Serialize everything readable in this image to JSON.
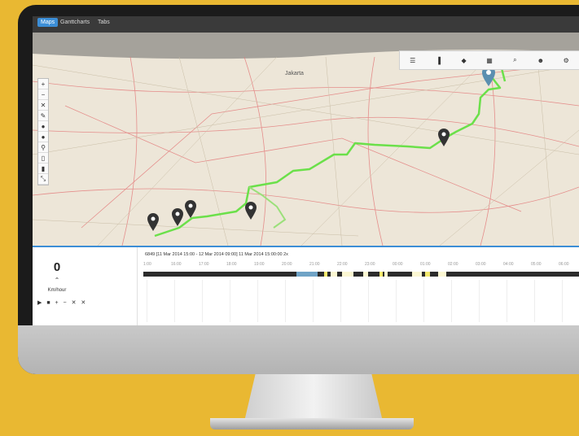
{
  "tabs": [
    {
      "label": "Maps",
      "active": true
    },
    {
      "label": "Ganttcharts",
      "active": false
    },
    {
      "label": "Tabs",
      "active": false
    }
  ],
  "map": {
    "city_label": "Jakarta",
    "markers": 7
  },
  "toolbar_icons": [
    "list-icon",
    "bookmark-icon",
    "layers-icon",
    "grid-icon",
    "search-icon",
    "user-icon",
    "settings-icon"
  ],
  "left_tools": [
    "zoom-in-icon",
    "zoom-out-icon",
    "close-icon",
    "pencil-icon",
    "point-icon",
    "point-icon",
    "marker-icon",
    "document-icon",
    "trash-icon",
    "resize-icon"
  ],
  "speed": {
    "value": "0",
    "unit": "Km/hour"
  },
  "controls_label": "▶ ■ + − ✕ ✕",
  "timeline": {
    "title": "6849 [11 Mar 2014 15:00 - 12 Mar 2014 09:00] 11 Mar 2014 15:00:00 2x",
    "ticks": [
      "1:00",
      "16:00",
      "17:00",
      "18:00",
      "19:00",
      "20:00",
      "21:00",
      "22:00",
      "23:00",
      "00:00",
      "01:00",
      "02:00",
      "03:00",
      "04:00",
      "05:00",
      "06:00"
    ]
  },
  "colors": {
    "route": "#6be04a",
    "accent": "#3c8ed6",
    "background": "#e9b832"
  }
}
